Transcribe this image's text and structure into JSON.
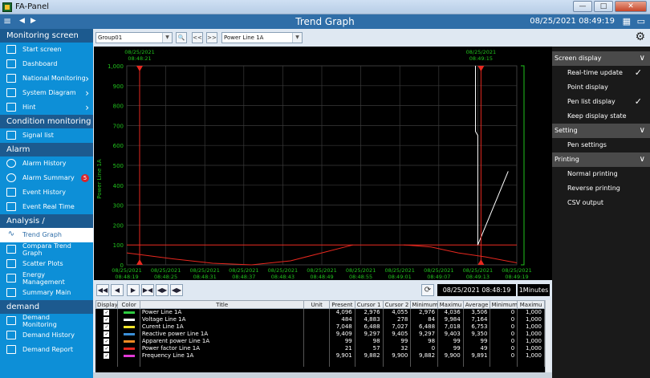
{
  "window": {
    "title": "FA-Panel",
    "minimize": "—",
    "maximize": "□",
    "close": "✕"
  },
  "header": {
    "title": "Trend Graph",
    "datetime": "08/25/2021 08:49:19",
    "menu_glyph": "≡",
    "back_glyph": "◀",
    "forward_glyph": "▶",
    "grid_glyph": "▦",
    "msg_glyph": "▭"
  },
  "sidebar": {
    "monitoring_title": "Monitoring screen",
    "start": "Start screen",
    "dashboard": "Dashboard",
    "national": "National Monitoring",
    "system": "System Diagram",
    "hint": "Hint",
    "condition_title": "Condition monitoring",
    "signal": "Signal list",
    "alarm_title": "Alarm",
    "alarm_history": "Alarm History",
    "alarm_summary": "Alarm Summary",
    "alarm_badge": "5",
    "event_history": "Event History",
    "event_realtime": "Event Real Time",
    "analysis_title": "Analysis / Aggregation",
    "trend": "Trend Graph",
    "compare_1": "Compara Trend",
    "compare_2": "Graph",
    "scatter": "Scatter Plots",
    "energy_1": "Energy",
    "energy_2": "Management",
    "summary": "Summary Main",
    "demand_title": "demand",
    "demand_mon_1": "Demand",
    "demand_mon_2": "Monitoring",
    "demand_history": "Demand History",
    "demand_report": "Demand Report",
    "chevron": "›"
  },
  "toolbar": {
    "group": "Group01",
    "search_glyph": "🔍",
    "prev": "<<",
    "next": ">>",
    "pen": "Power Line 1A",
    "dropdown_glyph": "▼"
  },
  "chart_data": {
    "type": "line",
    "ylabel": "Power Line 1A",
    "yticks": [
      "0",
      "100",
      "200",
      "300",
      "400",
      "500",
      "600",
      "700",
      "800",
      "900",
      "1,000"
    ],
    "ylim": [
      0,
      1000
    ],
    "cursor1_date": "08/25/2021",
    "cursor1_time": "08:48:21",
    "cursor2_date": "08/25/2021",
    "cursor2_time": "08:49:15",
    "xticks": [
      {
        "d": "08/25/2021",
        "t": "08:48:19"
      },
      {
        "d": "08/25/2021",
        "t": "08:48:25"
      },
      {
        "d": "08/25/2021",
        "t": "08:48:31"
      },
      {
        "d": "08/25/2021",
        "t": "08:48:37"
      },
      {
        "d": "08/25/2021",
        "t": "08:48:43"
      },
      {
        "d": "08/25/2021",
        "t": "08:48:49"
      },
      {
        "d": "08/25/2021",
        "t": "08:48:55"
      },
      {
        "d": "08/25/2021",
        "t": "08:49:01"
      },
      {
        "d": "08/25/2021",
        "t": "08:49:07"
      },
      {
        "d": "08/25/2021",
        "t": "08:49:13"
      },
      {
        "d": "08/25/2021",
        "t": "08:49:19"
      }
    ],
    "grid": true,
    "colors": {
      "axis": "#21c21d",
      "power_line": "#e8281f",
      "voltage_line": "#ffffff",
      "cursor": "#e8281f"
    }
  },
  "right_panel": {
    "gear_glyph": "⚙",
    "screen_display": "Screen display",
    "realtime": "Real-time update",
    "point_display": "Point display",
    "pen_list": "Pen list display",
    "keep_state": "Keep display state",
    "setting": "Setting",
    "pen_settings": "Pen settings",
    "printing": "Printing",
    "normal_printing": "Normal printing",
    "reverse_printing": "Reverse printing",
    "csv": "CSV output",
    "check": "✓",
    "chev": "∨"
  },
  "nav": {
    "b1": "◀◀",
    "b2": "◀",
    "b3": "▶",
    "b4": "▶◀",
    "b5": "◀▶",
    "b6": "◀▶",
    "refresh": "⟳",
    "datetime": "08/25/2021 08:48:19",
    "interval": "1Minutes"
  },
  "table": {
    "headers": [
      "Display",
      "Color",
      "Title",
      "Unit",
      "Present",
      "Cursor 1",
      "Cursor 2",
      "Minimum",
      "Maximu",
      "Average",
      "Minimum",
      "Maximu"
    ],
    "rows": [
      {
        "color": "#2ecc40",
        "title": "Power Line 1A",
        "unit": "",
        "present": "4,096",
        "c1": "2,976",
        "c2": "4,055",
        "min": "2,976",
        "max": "4,036",
        "avg": "3,506",
        "min2": "0",
        "max2": "1,000"
      },
      {
        "color": "#ffffff",
        "title": "Voltage Line 1A",
        "unit": "",
        "present": "484",
        "c1": "4,883",
        "c2": "278",
        "min": "84",
        "max": "9,984",
        "avg": "7,164",
        "min2": "0",
        "max2": "1,000"
      },
      {
        "color": "#f2e32b",
        "title": "Curent Line 1A",
        "unit": "",
        "present": "7,048",
        "c1": "6,488",
        "c2": "7,027",
        "min": "6,488",
        "max": "7,018",
        "avg": "6,753",
        "min2": "0",
        "max2": "1,000"
      },
      {
        "color": "#3b8fd8",
        "title": "Reactive power Line 1A",
        "unit": "",
        "present": "9,409",
        "c1": "9,297",
        "c2": "9,405",
        "min": "9,297",
        "max": "9,403",
        "avg": "9,350",
        "min2": "0",
        "max2": "1,000"
      },
      {
        "color": "#f08a24",
        "title": "Apparent power Line 1A",
        "unit": "",
        "present": "99",
        "c1": "98",
        "c2": "99",
        "min": "98",
        "max": "99",
        "avg": "99",
        "min2": "0",
        "max2": "1,000"
      },
      {
        "color": "#e8281f",
        "title": "Power factor Line 1A",
        "unit": "",
        "present": "21",
        "c1": "57",
        "c2": "32",
        "min": "0",
        "max": "99",
        "avg": "49",
        "min2": "0",
        "max2": "1,000"
      },
      {
        "color": "#e23ad6",
        "title": "Frequency Line 1A",
        "unit": "",
        "present": "9,901",
        "c1": "9,882",
        "c2": "9,900",
        "min": "9,882",
        "max": "9,900",
        "avg": "9,891",
        "min2": "0",
        "max2": "1,000"
      }
    ]
  }
}
